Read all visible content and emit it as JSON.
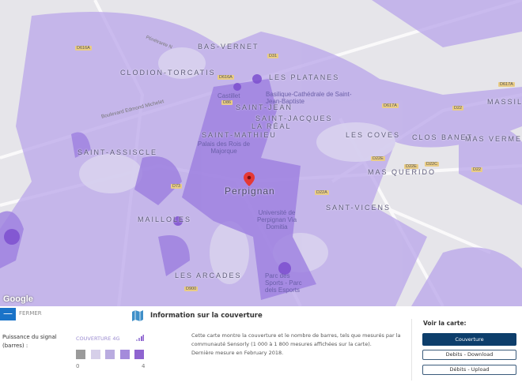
{
  "map": {
    "city": "Perpignan",
    "attribution": "Google",
    "districts": [
      "BAS-VERNET",
      "CLODION-TORCATIS",
      "LES PLATANES",
      "SAINT-JEAN",
      "SAINT-JACQUES",
      "LA RÉAL",
      "SAINT-MATHIEU",
      "SAINT-ASSISCLE",
      "LES COVES",
      "CLOS BANET",
      "MAS VERMEIL",
      "MASSILI",
      "MAS QUERIDO",
      "SANT-VICENS",
      "MAILLOLES",
      "LES ARCADES"
    ],
    "pois": [
      "Castillet",
      "Basilique-Cathédrale de Saint-Jean-Baptiste",
      "Palais des Rois de Majorque",
      "Université de Perpignan Via Domitia",
      "Parc des Sports - Parc dels Esports"
    ],
    "roads": [
      "D616A",
      "D31",
      "D616A",
      "D86",
      "D617A",
      "D22",
      "D22E",
      "D22E",
      "D22C",
      "D22",
      "D22A",
      "D73",
      "D900",
      "D617A",
      "Boulevard Edmond Michelet",
      "Pénétrante N"
    ],
    "colors": {
      "coverage_light": "#c9bdf0",
      "coverage_mid": "#a78ee0",
      "coverage_dark": "#8b62d6",
      "marker": "#e53935"
    }
  },
  "panel": {
    "close_label": "FERMER",
    "signal_label": "Puissance du signal (barres) :",
    "legend_title": "COUVERTURE 4G",
    "legend_min": "0",
    "legend_max": "4",
    "legend_colors": [
      "#9a9a9a",
      "#d6cfe9",
      "#b9abe0",
      "#a48bdb",
      "#8f64d0"
    ],
    "info_title": "Information sur la couverture",
    "info_line1": "Cette carte montre la couverture et le nombre de barres, tels que mesurés par la communauté Sensorly (1 000 à 1 800 mesures affichées sur la carte).",
    "info_line2": "Dernière mesure en February 2018.",
    "view_label": "Voir la carte:",
    "buttons": [
      "Couverture",
      "Debits - Download",
      "Débits - Upload"
    ]
  }
}
